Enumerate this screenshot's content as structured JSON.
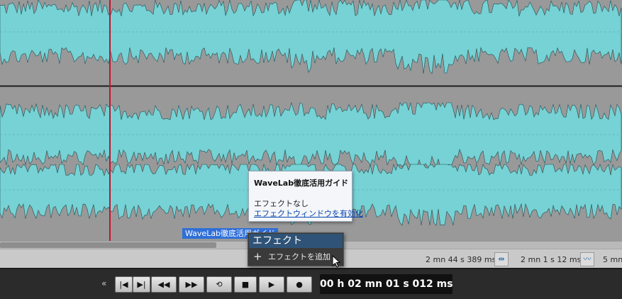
{
  "clip": {
    "name": "WaveLab徹底活用ガイド"
  },
  "tooltip": {
    "title": "WaveLab徹底活用ガイド",
    "effect_status": "エフェクトなし",
    "link": "エフェクトウィンドウを有効化"
  },
  "context_menu": {
    "header": "エフェクト",
    "items": [
      {
        "icon": "plus-icon",
        "label": "エフェクトを追加"
      }
    ]
  },
  "status_bar": {
    "length": "2 mn 44 s 389 ms",
    "position": "2 mn 1 s 12 ms",
    "extra": "5 mn"
  },
  "transport": {
    "buttons": [
      {
        "name": "go-to-start-button",
        "icon": "|◀"
      },
      {
        "name": "go-to-end-button",
        "icon": "▶|"
      },
      {
        "name": "rewind-button",
        "icon": "◀◀"
      },
      {
        "name": "fast-forward-button",
        "icon": "▶▶"
      },
      {
        "name": "loop-button",
        "icon": "⟲"
      },
      {
        "name": "stop-button",
        "icon": "■"
      },
      {
        "name": "play-button",
        "icon": "▶"
      },
      {
        "name": "record-button",
        "icon": "●"
      }
    ],
    "timecode": "00 h 02 mn 01 s 012 ms"
  },
  "colors": {
    "waveform": "#76d2d4",
    "background": "#999999",
    "cursor": "#c8102e",
    "selection": "#2f6fd8"
  }
}
